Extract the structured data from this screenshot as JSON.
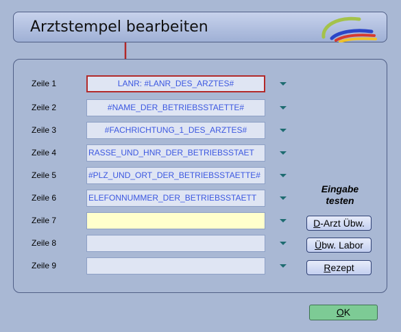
{
  "dialog": {
    "title": "Arztstempel bearbeiten",
    "logo_icon": "colored-arcs-logo-icon"
  },
  "rows": [
    {
      "label": "Zeile 1",
      "value": "LANR: #LANR_DES_ARZTES#"
    },
    {
      "label": "Zeile 2",
      "value": "#NAME_DER_BETRIEBSSTAETTE#"
    },
    {
      "label": "Zeile 3",
      "value": "#FACHRICHTUNG_1_DES_ARZTES#"
    },
    {
      "label": "Zeile 4",
      "value": "RASSE_UND_HNR_DER_BETRIEBSSTAET"
    },
    {
      "label": "Zeile 5",
      "value": "#PLZ_UND_ORT_DER_BETRIEBSSTAETTE#"
    },
    {
      "label": "Zeile 6",
      "value": "ELEFONNUMMER_DER_BETRIEBSSTAETT"
    },
    {
      "label": "Zeile 7",
      "value": ""
    },
    {
      "label": "Zeile 8",
      "value": ""
    },
    {
      "label": "Zeile 9",
      "value": ""
    }
  ],
  "test": {
    "heading_line1": "Eingabe",
    "heading_line2": "testen",
    "darzt": {
      "accel": "D",
      "rest": "-Arzt Übw."
    },
    "labor": {
      "accel": "Ü",
      "rest": "bw. Labor"
    },
    "rezept": {
      "accel": "R",
      "rest": "ezept"
    }
  },
  "ok": {
    "accel": "O",
    "rest": "K"
  },
  "colors": {
    "selected_border": "#b22828",
    "active_field": "#ffffcc",
    "field_text": "#3b57e0",
    "ok_button": "#7dcb95"
  }
}
